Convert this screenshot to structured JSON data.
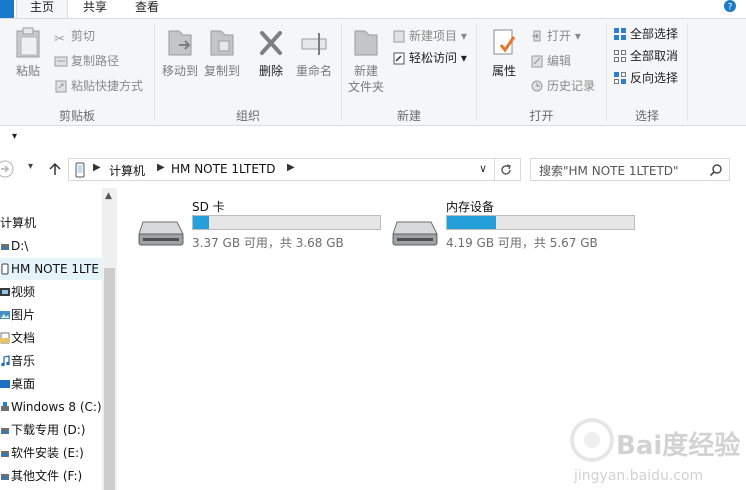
{
  "tabs": [
    {
      "label": "主页",
      "active": true
    },
    {
      "label": "共享",
      "active": false
    },
    {
      "label": "查看",
      "active": false
    }
  ],
  "ribbon": {
    "clipboard": {
      "group_label": "剪贴板",
      "paste": "粘贴",
      "cut": "剪切",
      "copy_path": "复制路径",
      "paste_shortcut": "粘贴快捷方式"
    },
    "organize": {
      "group_label": "组织",
      "move_to": "移动到",
      "copy_to": "复制到",
      "delete": "删除",
      "rename": "重命名"
    },
    "new": {
      "group_label": "新建",
      "new_folder_line1": "新建",
      "new_folder_line2": "文件夹",
      "new_item": "新建项目",
      "easy_access": "轻松访问"
    },
    "open": {
      "group_label": "打开",
      "properties": "属性",
      "open": "打开",
      "edit": "编辑",
      "history": "历史记录"
    },
    "select": {
      "group_label": "选择",
      "select_all": "全部选择",
      "select_none": "全部取消",
      "invert": "反向选择"
    }
  },
  "address": {
    "crumbs": [
      "计算机",
      "HM NOTE 1LTETD"
    ],
    "search_placeholder": "搜索\"HM NOTE 1LTETD\""
  },
  "nav": {
    "items": [
      {
        "label": "计算机",
        "icon": "computer-icon"
      },
      {
        "label": "D:\\",
        "icon": "drive-icon"
      },
      {
        "label": "HM NOTE 1LTE",
        "icon": "phone-icon",
        "selected": true
      },
      {
        "label": "视频",
        "icon": "video-icon"
      },
      {
        "label": "图片",
        "icon": "pictures-icon"
      },
      {
        "label": "文档",
        "icon": "documents-icon"
      },
      {
        "label": "音乐",
        "icon": "music-icon"
      },
      {
        "label": "桌面",
        "icon": "desktop-icon"
      },
      {
        "label": "Windows 8 (C:)",
        "icon": "drive-icon"
      },
      {
        "label": "下载专用 (D:)",
        "icon": "drive-icon"
      },
      {
        "label": "软件安装 (E:)",
        "icon": "drive-icon"
      },
      {
        "label": "其他文件 (F:)",
        "icon": "drive-icon"
      }
    ]
  },
  "drives": [
    {
      "name": "SD 卡",
      "info": "3.37 GB 可用，共 3.68 GB",
      "used_fraction": 0.085
    },
    {
      "name": "内存设备",
      "info": "4.19 GB 可用，共 5.67 GB",
      "used_fraction": 0.26
    }
  ],
  "watermark": {
    "brand": "Bai度经验",
    "url": "jingyan.baidu.com"
  },
  "colors": {
    "accent": "#26a0da",
    "ribbon_bg": "#f5f6f7",
    "selected_bg": "#e5f3fb"
  }
}
